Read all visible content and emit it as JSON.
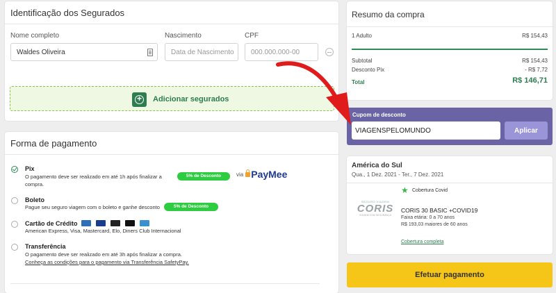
{
  "insured": {
    "title": "Identificação dos Segurados",
    "name_label": "Nome completo",
    "name_value": "Waldes Oliveira",
    "birth_label": "Nascimento",
    "birth_placeholder": "Data de Nascimento",
    "cpf_label": "CPF",
    "cpf_placeholder": "000.000.000-00",
    "add_button": "Adicionar segurados"
  },
  "payment": {
    "title": "Forma de pagamento",
    "options": [
      {
        "title": "Pix",
        "desc_1": "O pagamento deve ser realizado em até 1h após finalizar a",
        "desc_2": "compra.",
        "badge": "5% de Desconto",
        "provider_via": "via",
        "provider_name": "PayMee",
        "selected": true
      },
      {
        "title": "Boleto",
        "desc_1": "Pague seu seguro viagem com o boleto e ganhe desconto",
        "badge": "5% de Desconto",
        "selected": false
      },
      {
        "title": "Cartão de Crédito",
        "desc_1": "American Express, Visa, Mastercard, Elo, Diners Club Internacional",
        "card_brands": [
          "amex",
          "visa",
          "mastercard",
          "elo",
          "diners"
        ],
        "selected": false
      },
      {
        "title": "Transferência",
        "desc_1": "O pagamento deve ser realizado em até 3h após finalizar a compra.",
        "link": "Conheça as condições para o pagamento via Transferência SafetyPay.",
        "selected": false
      }
    ]
  },
  "summary": {
    "title": "Resumo da compra",
    "item_label": "1 Adulto",
    "item_value": "R$ 154,43",
    "subtotal_label": "Subtotal",
    "subtotal_value": "R$ 154,43",
    "discount_label": "Desconto Pix",
    "discount_value": "- R$ 7,72",
    "total_label": "Total",
    "total_value": "R$ 146,71"
  },
  "coupon": {
    "title": "Cupom de desconto",
    "value": "VIAGENSPELOMUNDO",
    "apply_button": "Aplicar"
  },
  "trip": {
    "destination": "América do Sul",
    "dates": "Qua., 1 Dez. 2021 - Ter., 7 Dez. 2021",
    "covid_label": "Cobertura Covid",
    "insurer_logo": "CORIS",
    "insurer_logo_top": "SEGURO VIAGEM",
    "insurer_logo_sub": "VIAGEM COM SEGURANÇA",
    "plan_name": "CORIS 30 BASIC +COVID19",
    "age_range": "Faixa etária: 0 a 70 anos",
    "senior_price": "R$ 193,03 maiores de 60 anos",
    "coverage_link": "Cobertura completa"
  },
  "pay_button": "Efetuar pagamento",
  "colors": {
    "brand_green": "#2e7d4f",
    "coupon_purple": "#6a63a6",
    "pay_yellow": "#f5c518",
    "badge_green": "#2ecc40",
    "arrow_red": "#e01b1b"
  }
}
